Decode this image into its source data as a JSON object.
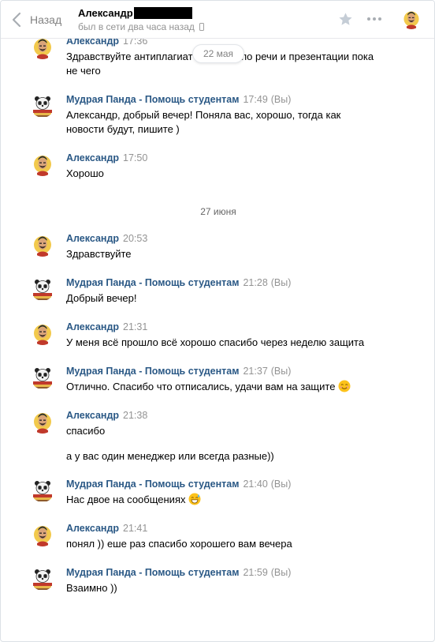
{
  "header": {
    "back_label": "Назад",
    "peer_name": "Александр",
    "peer_status": "был в сети два часа назад"
  },
  "floating_date": "22 мая",
  "colors": {
    "author": "#2a5885",
    "time": "#939393",
    "border": "#dce1e6"
  },
  "messages": [
    {
      "author": "Александр",
      "time": "17:36",
      "text": "Здравствуйте антиплагиат пройден, по речи и презентации пока не чего"
    },
    {
      "author": "Мудрая Панда - Помощь студентам",
      "time": "17:49",
      "you": "(Вы)",
      "text": "Александр, добрый вечер! Поняла вас, хорошо, тогда как новости будут, пишите )"
    },
    {
      "author": "Александр",
      "time": "17:50",
      "text": "Хорошо"
    },
    {
      "author": "Александр",
      "time": "20:53",
      "text": "Здравствуйте"
    },
    {
      "author": "Мудрая Панда - Помощь студентам",
      "time": "21:28",
      "you": "(Вы)",
      "text": "Добрый вечер!"
    },
    {
      "author": "Александр",
      "time": "21:31",
      "text": "У меня всё прошло всё хорошо спасибо через неделю защита"
    },
    {
      "author": "Мудрая Панда - Помощь студентам",
      "time": "21:37",
      "you": "(Вы)",
      "text": "Отлично. Спасибо что отписались, удачи вам на защите"
    },
    {
      "author": "Александр",
      "time": "21:38",
      "text": "спасибо",
      "text2": "а у вас один менеджер или всегда разные))"
    },
    {
      "author": "Мудрая Панда - Помощь студентам",
      "time": "21:40",
      "you": "(Вы)",
      "text": "Нас двое на сообщениях"
    },
    {
      "author": "Александр",
      "time": "21:41",
      "text": "понял )) еше раз спасибо хорошего вам вечера"
    },
    {
      "author": "Мудрая Панда - Помощь студентам",
      "time": "21:59",
      "you": "(Вы)",
      "text": "Взаимно ))"
    }
  ],
  "date_separator": "27 июня"
}
